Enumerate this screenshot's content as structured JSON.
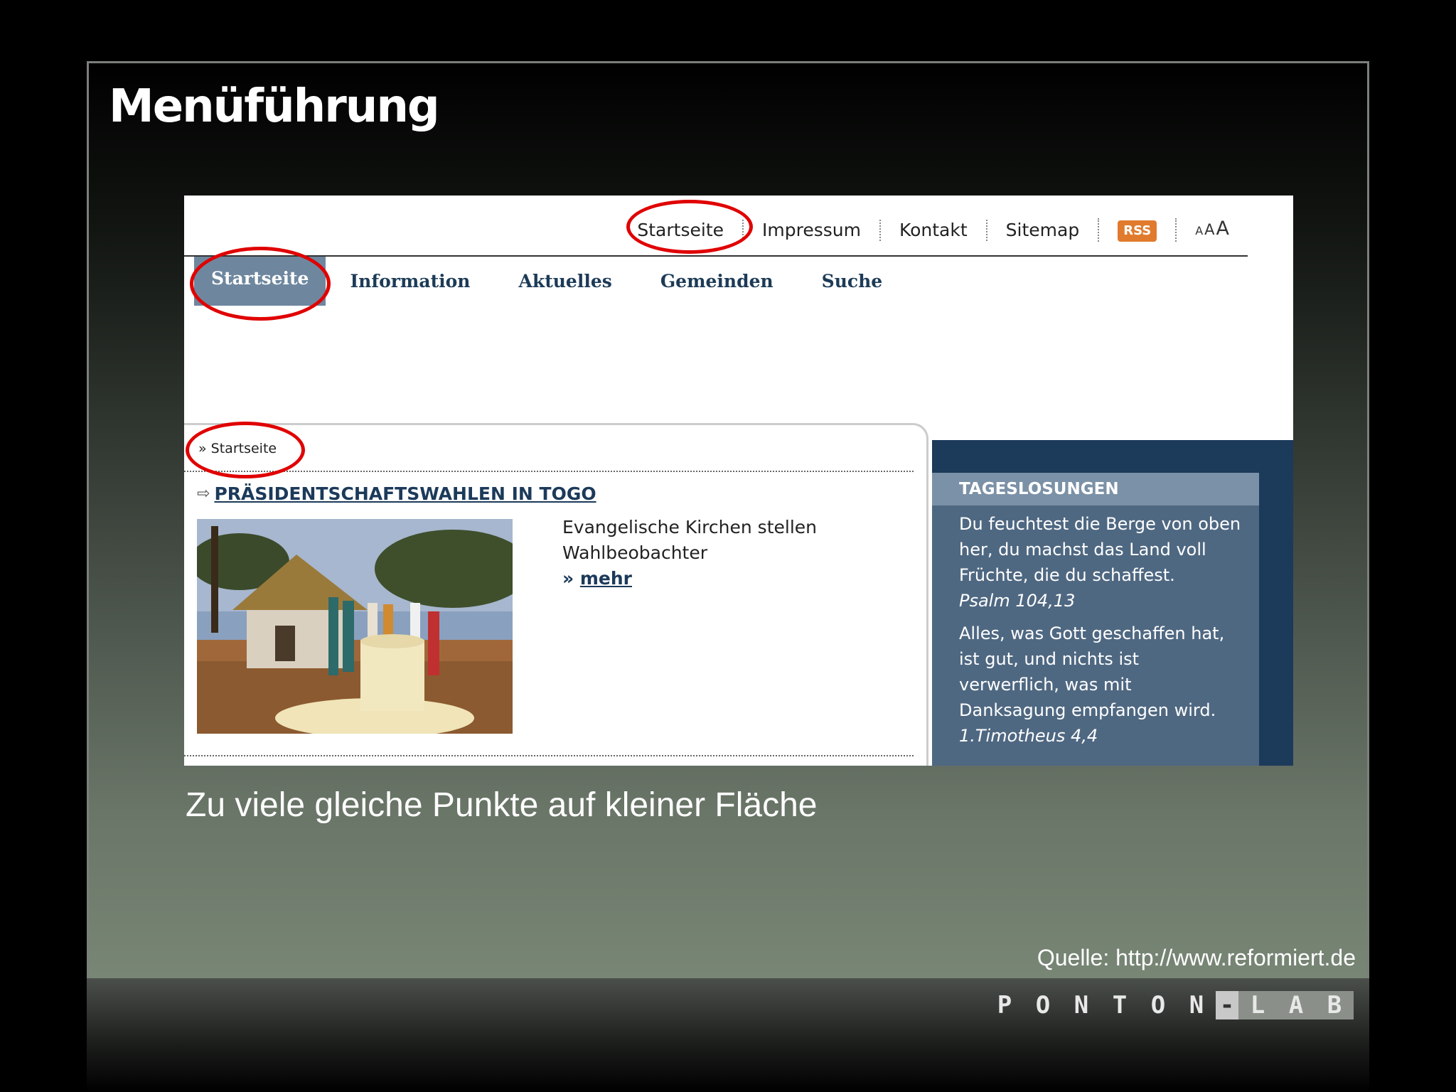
{
  "slide": {
    "title": "Menüführung",
    "caption": "Zu viele gleiche Punkte auf kleiner Fläche",
    "source": "Quelle: http://www.reformiert.de"
  },
  "site": {
    "top_nav": [
      "Startseite",
      "Impressum",
      "Kontakt",
      "Sitemap"
    ],
    "rss": "RSS",
    "font_sizes": [
      "A",
      "A",
      "A"
    ],
    "main_nav": [
      "Startseite",
      "Information",
      "Aktuelles",
      "Gemeinden",
      "Suche"
    ],
    "breadcrumb": "Startseite",
    "news": {
      "title": "PRÄSIDENTSCHAFTSWAHLEN IN TOGO",
      "teaser_line1": "Evangelische Kirchen stellen",
      "teaser_line2": "Wahlbeobachter",
      "more": "mehr"
    },
    "losungen": {
      "heading": "TAGESLOSUNGEN",
      "text1": "Du feuchtest die Berge von oben her, du machst das Land voll Früchte, die du schaffest.",
      "ref1": "Psalm 104,13",
      "text2": "Alles, was Gott geschaffen hat, ist gut, und nichts ist verwerflich, was mit Danksagung empfangen wird.",
      "ref2": "1.Timotheus 4,4"
    }
  },
  "logo": {
    "letters": [
      "P",
      "O",
      "N",
      "T",
      "O",
      "N",
      "-",
      "L",
      "A",
      "B"
    ]
  },
  "colors": {
    "highlight": "#e00000",
    "nav_active": "#6e879f",
    "sidebar": "#1c3a5a"
  }
}
